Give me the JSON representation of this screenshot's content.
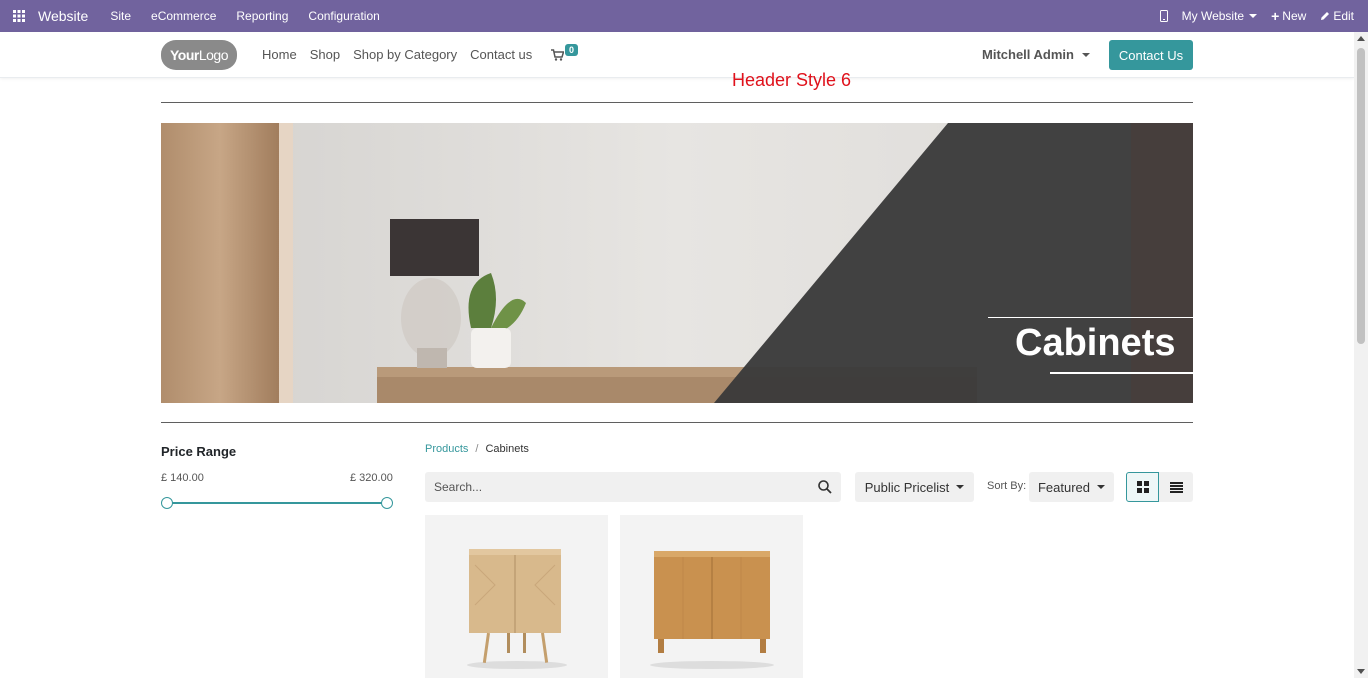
{
  "admin_bar": {
    "app_name": "Website",
    "menu": [
      "Site",
      "eCommerce",
      "Reporting",
      "Configuration"
    ],
    "my_website": "My Website",
    "new_label": "New",
    "edit_label": "Edit"
  },
  "header": {
    "logo_text_bold": "Your",
    "logo_text_rest": "Logo",
    "nav": [
      "Home",
      "Shop",
      "Shop by Category",
      "Contact us"
    ],
    "cart_count": "0",
    "user_name": "Mitchell Admin",
    "contact_button": "Contact Us",
    "style_label": "Header Style 6"
  },
  "banner": {
    "title": "Cabinets"
  },
  "filter": {
    "title": "Price Range",
    "min_label": "£ 140.00",
    "max_label": "£ 320.00"
  },
  "breadcrumb": {
    "parent": "Products",
    "separator": "/",
    "current": "Cabinets"
  },
  "toolbar": {
    "search_placeholder": "Search...",
    "pricelist": "Public Pricelist",
    "sort_by_label": "Sort By:",
    "sort_value": "Featured"
  },
  "colors": {
    "admin_bar": "#71639e",
    "accent": "#35979c",
    "style_label": "#e0111b"
  }
}
